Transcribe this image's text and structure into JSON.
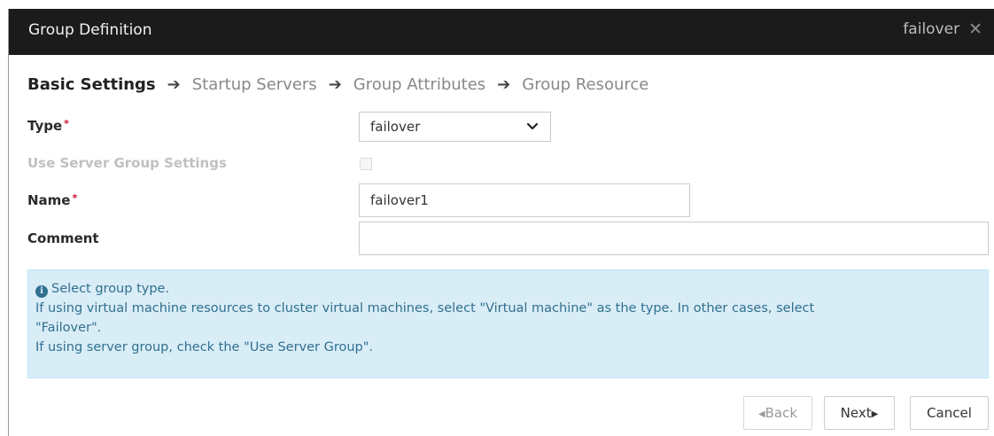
{
  "dialog": {
    "title": "Group Definition",
    "group_name": "failover",
    "close_icon": "close-icon"
  },
  "steps": [
    {
      "label": "Basic Settings",
      "active": true
    },
    {
      "label": "Startup Servers",
      "active": false
    },
    {
      "label": "Group Attributes",
      "active": false
    },
    {
      "label": "Group Resource",
      "active": false
    }
  ],
  "form": {
    "type_label": "Type",
    "type_value": "failover",
    "use_server_group_label": "Use Server Group Settings",
    "use_server_group_checked": false,
    "name_label": "Name",
    "name_value": "failover1",
    "comment_label": "Comment",
    "comment_value": "",
    "required_mark": "*"
  },
  "info": {
    "line1": "Select group type.",
    "line2": "If using virtual machine resources to cluster virtual machines, select \"Virtual machine\" as the type. In other cases, select",
    "line3": "\"Failover\".",
    "line4": "If using server group, check the \"Use Server Group\"."
  },
  "buttons": {
    "back": "Back",
    "next": "Next",
    "cancel": "Cancel"
  },
  "colors": {
    "titlebar": "#1b1b1b",
    "info_bg": "#d9edf7",
    "info_text": "#31708f",
    "required": "#c8102e"
  }
}
